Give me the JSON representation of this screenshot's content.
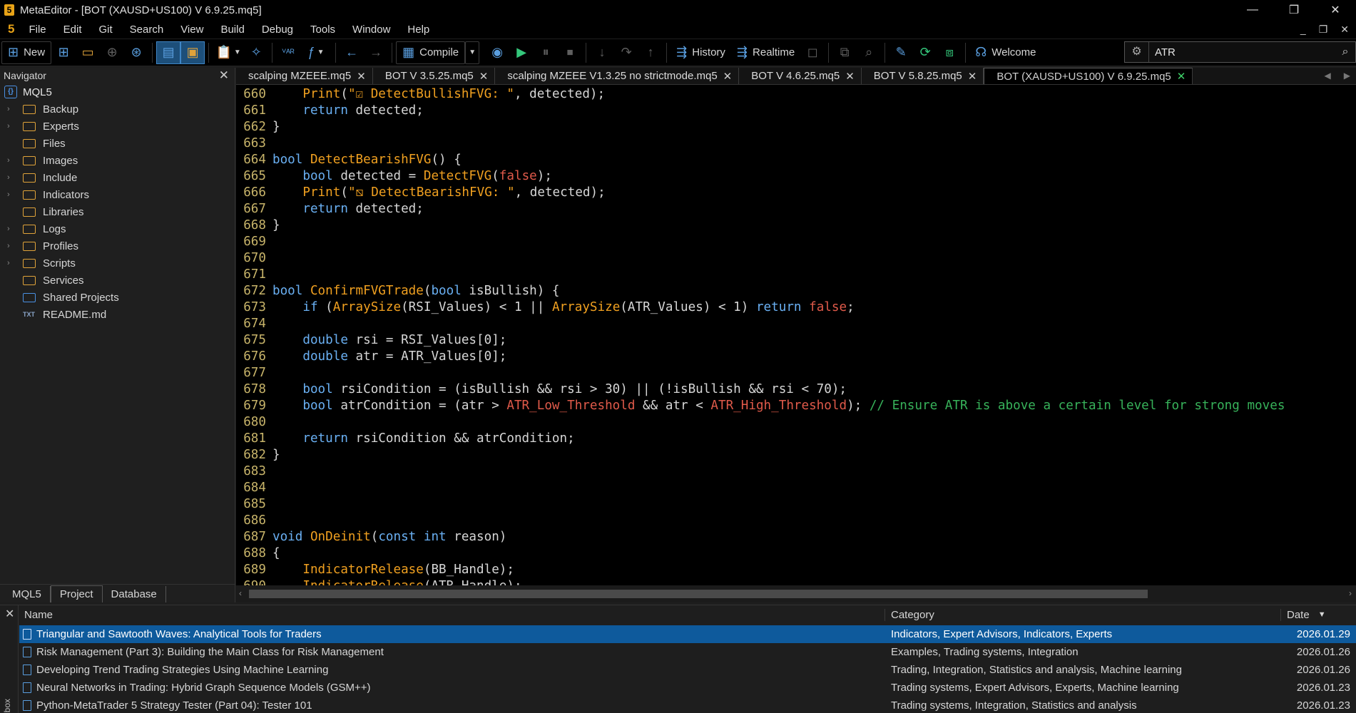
{
  "window": {
    "title": "MetaEditor - [BOT (XAUSD+US100) V 6.9.25.mq5]",
    "controls": [
      "—",
      "❐",
      "✕"
    ],
    "inner_controls": [
      "_",
      "❐",
      "✕"
    ]
  },
  "menu": {
    "logo": "5",
    "items": [
      "File",
      "Edit",
      "Git",
      "Search",
      "View",
      "Build",
      "Debug",
      "Tools",
      "Window",
      "Help"
    ]
  },
  "toolbar": {
    "new_label": "New",
    "compile_label": "Compile",
    "history_label": "History",
    "realtime_label": "Realtime",
    "welcome_label": "Welcome",
    "search_value": "ATR",
    "search_placeholder": "Search"
  },
  "navigator": {
    "title": "Navigator",
    "root": "MQL5",
    "items": [
      {
        "label": "Backup",
        "expandable": true
      },
      {
        "label": "Experts",
        "expandable": true
      },
      {
        "label": "Files",
        "expandable": false
      },
      {
        "label": "Images",
        "expandable": true
      },
      {
        "label": "Include",
        "expandable": true
      },
      {
        "label": "Indicators",
        "expandable": true
      },
      {
        "label": "Libraries",
        "expandable": false
      },
      {
        "label": "Logs",
        "expandable": true
      },
      {
        "label": "Profiles",
        "expandable": true
      },
      {
        "label": "Scripts",
        "expandable": true
      },
      {
        "label": "Services",
        "expandable": false
      },
      {
        "label": "Shared Projects",
        "expandable": false
      },
      {
        "label": "README.md",
        "expandable": false
      }
    ],
    "tabs": [
      "MQL5",
      "Project",
      "Database"
    ]
  },
  "editor": {
    "tabs": [
      {
        "label": "scalping MZEEE.mq5",
        "active": false
      },
      {
        "label": "BOT V 3.5.25.mq5",
        "active": false
      },
      {
        "label": "scalping MZEEE V1.3.25 no strictmode.mq5",
        "active": false
      },
      {
        "label": "BOT V 4.6.25.mq5",
        "active": false
      },
      {
        "label": "BOT V 5.8.25.mq5",
        "active": false
      },
      {
        "label": "BOT (XAUSD+US100) V 6.9.25.mq5",
        "active": true
      }
    ],
    "lines": [
      {
        "n": "660",
        "tokens": [
          [
            "t",
            "    "
          ],
          [
            "fn",
            "Print"
          ],
          [
            "t",
            "("
          ],
          [
            "str",
            "\"☑ DetectBullishFVG: \""
          ],
          [
            "t",
            ", detected);"
          ]
        ]
      },
      {
        "n": "661",
        "tokens": [
          [
            "t",
            "    "
          ],
          [
            "kw",
            "return"
          ],
          [
            "t",
            " detected;"
          ]
        ]
      },
      {
        "n": "662",
        "tokens": [
          [
            "t",
            "}"
          ]
        ]
      },
      {
        "n": "663",
        "tokens": []
      },
      {
        "n": "664",
        "tokens": [
          [
            "kw",
            "bool"
          ],
          [
            "t",
            " "
          ],
          [
            "fn",
            "DetectBearishFVG"
          ],
          [
            "t",
            "() {"
          ]
        ]
      },
      {
        "n": "665",
        "tokens": [
          [
            "t",
            "    "
          ],
          [
            "kw",
            "bool"
          ],
          [
            "t",
            " detected = "
          ],
          [
            "fn",
            "DetectFVG"
          ],
          [
            "t",
            "("
          ],
          [
            "lit",
            "false"
          ],
          [
            "t",
            ");"
          ]
        ]
      },
      {
        "n": "666",
        "tokens": [
          [
            "t",
            "    "
          ],
          [
            "fn",
            "Print"
          ],
          [
            "t",
            "("
          ],
          [
            "str",
            "\"⧅ DetectBearishFVG: \""
          ],
          [
            "t",
            ", detected);"
          ]
        ]
      },
      {
        "n": "667",
        "tokens": [
          [
            "t",
            "    "
          ],
          [
            "kw",
            "return"
          ],
          [
            "t",
            " detected;"
          ]
        ]
      },
      {
        "n": "668",
        "tokens": [
          [
            "t",
            "}"
          ]
        ]
      },
      {
        "n": "669",
        "tokens": []
      },
      {
        "n": "670",
        "tokens": []
      },
      {
        "n": "671",
        "tokens": []
      },
      {
        "n": "672",
        "tokens": [
          [
            "kw",
            "bool"
          ],
          [
            "t",
            " "
          ],
          [
            "fn",
            "ConfirmFVGTrade"
          ],
          [
            "t",
            "("
          ],
          [
            "kw",
            "bool"
          ],
          [
            "t",
            " isBullish) {"
          ]
        ]
      },
      {
        "n": "673",
        "tokens": [
          [
            "t",
            "    "
          ],
          [
            "kw",
            "if"
          ],
          [
            "t",
            " ("
          ],
          [
            "fn",
            "ArraySize"
          ],
          [
            "t",
            "(RSI_Values) < 1 || "
          ],
          [
            "fn",
            "ArraySize"
          ],
          [
            "t",
            "(ATR_Values) < 1) "
          ],
          [
            "kw",
            "return"
          ],
          [
            "t",
            " "
          ],
          [
            "lit",
            "false"
          ],
          [
            "t",
            ";"
          ]
        ]
      },
      {
        "n": "674",
        "tokens": []
      },
      {
        "n": "675",
        "tokens": [
          [
            "t",
            "    "
          ],
          [
            "kw",
            "double"
          ],
          [
            "t",
            " rsi = RSI_Values[0];"
          ]
        ]
      },
      {
        "n": "676",
        "tokens": [
          [
            "t",
            "    "
          ],
          [
            "kw",
            "double"
          ],
          [
            "t",
            " atr = ATR_Values[0];"
          ]
        ]
      },
      {
        "n": "677",
        "tokens": []
      },
      {
        "n": "678",
        "tokens": [
          [
            "t",
            "    "
          ],
          [
            "kw",
            "bool"
          ],
          [
            "t",
            " rsiCondition = (isBullish && rsi > 30) || (!isBullish && rsi < 70);"
          ]
        ]
      },
      {
        "n": "679",
        "tokens": [
          [
            "t",
            "    "
          ],
          [
            "kw",
            "bool"
          ],
          [
            "t",
            " atrCondition = (atr > "
          ],
          [
            "lit",
            "ATR_Low_Threshold"
          ],
          [
            "t",
            " && atr < "
          ],
          [
            "lit",
            "ATR_High_Threshold"
          ],
          [
            "t",
            "); "
          ],
          [
            "cm",
            "// Ensure ATR is above a certain level for strong moves"
          ]
        ]
      },
      {
        "n": "680",
        "tokens": []
      },
      {
        "n": "681",
        "tokens": [
          [
            "t",
            "    "
          ],
          [
            "kw",
            "return"
          ],
          [
            "t",
            " rsiCondition && atrCondition;"
          ]
        ]
      },
      {
        "n": "682",
        "tokens": [
          [
            "t",
            "}"
          ]
        ]
      },
      {
        "n": "683",
        "tokens": []
      },
      {
        "n": "684",
        "tokens": []
      },
      {
        "n": "685",
        "tokens": []
      },
      {
        "n": "686",
        "tokens": []
      },
      {
        "n": "687",
        "tokens": [
          [
            "kw",
            "void"
          ],
          [
            "t",
            " "
          ],
          [
            "fn",
            "OnDeinit"
          ],
          [
            "t",
            "("
          ],
          [
            "kw",
            "const"
          ],
          [
            "t",
            " "
          ],
          [
            "kw",
            "int"
          ],
          [
            "t",
            " reason)"
          ]
        ]
      },
      {
        "n": "688",
        "tokens": [
          [
            "t",
            "{"
          ]
        ]
      },
      {
        "n": "689",
        "tokens": [
          [
            "t",
            "    "
          ],
          [
            "fn",
            "IndicatorRelease"
          ],
          [
            "t",
            "(BB_Handle);"
          ]
        ]
      },
      {
        "n": "690",
        "tokens": [
          [
            "t",
            "    "
          ],
          [
            "fn",
            "IndicatorRelease"
          ],
          [
            "t",
            "(ATR_Handle);"
          ]
        ]
      }
    ]
  },
  "articles": {
    "columns": [
      "Name",
      "Category",
      "Date"
    ],
    "side_label": "box",
    "rows": [
      {
        "name": "Triangular and Sawtooth Waves: Analytical Tools for Traders",
        "category": "Indicators, Expert Advisors, Indicators, Experts",
        "date": "2026.01.29",
        "selected": true
      },
      {
        "name": "Risk Management (Part 3): Building the Main Class for Risk Management",
        "category": "Examples, Trading systems, Integration",
        "date": "2026.01.26",
        "selected": false
      },
      {
        "name": "Developing Trend Trading Strategies Using Machine Learning",
        "category": "Trading, Integration, Statistics and analysis, Machine learning",
        "date": "2026.01.26",
        "selected": false
      },
      {
        "name": "Neural Networks in Trading: Hybrid Graph Sequence Models (GSM++)",
        "category": "Trading systems, Expert Advisors, Experts, Machine learning",
        "date": "2026.01.23",
        "selected": false
      },
      {
        "name": "Python-MetaTrader 5 Strategy Tester (Part 04): Tester 101",
        "category": "Trading systems, Integration, Statistics and analysis",
        "date": "2026.01.23",
        "selected": false
      }
    ]
  },
  "colors": {
    "accent": "#0e5a9c",
    "keyword": "#6ab0f3",
    "function": "#f0a020",
    "literal": "#e05a4a",
    "comment": "#37b25a",
    "line_number": "#c8b46a"
  }
}
